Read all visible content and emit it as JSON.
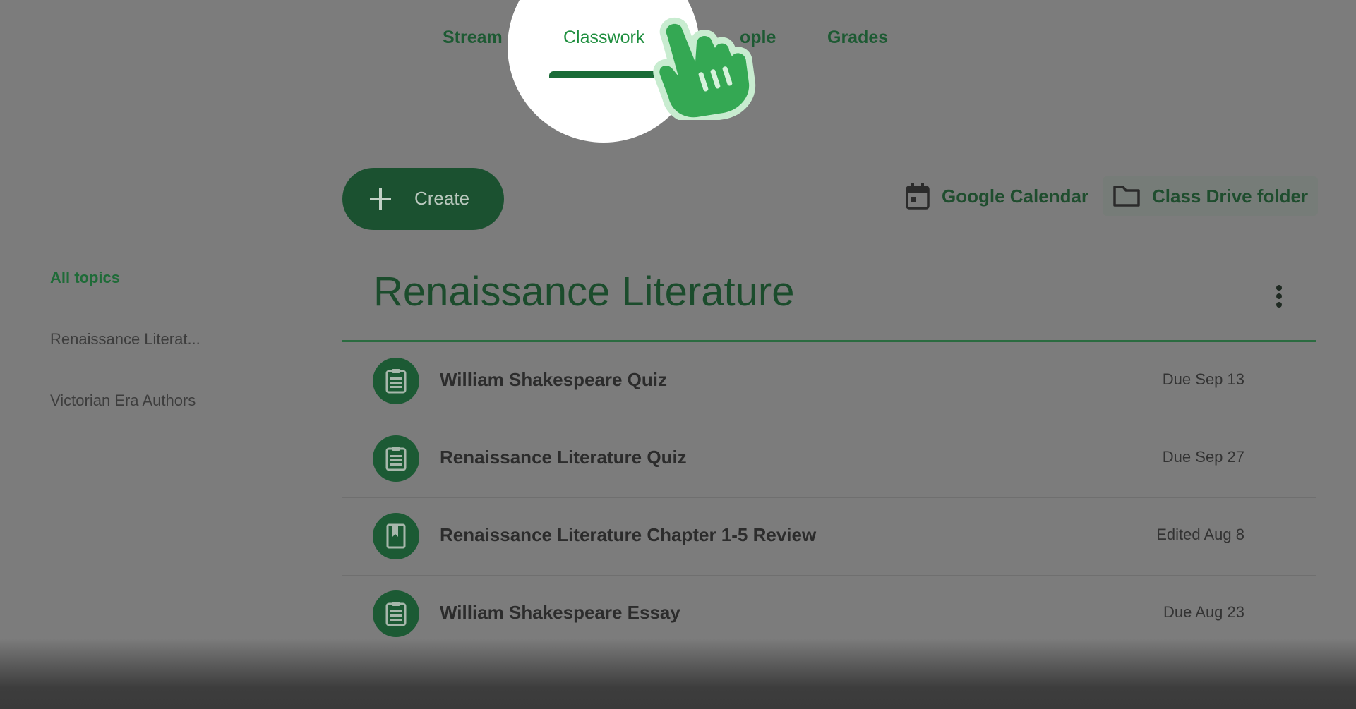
{
  "tabs": {
    "stream": "Stream",
    "classwork": "Classwork",
    "people": "ople",
    "grades": "Grades"
  },
  "toolbar": {
    "create_label": "Create",
    "calendar_label": "Google Calendar",
    "drive_label": "Class Drive folder"
  },
  "sidebar": {
    "items": [
      {
        "label": "All topics"
      },
      {
        "label": "Renaissance Literat..."
      },
      {
        "label": "Victorian Era Authors"
      }
    ]
  },
  "topic": {
    "title": "Renaissance Literature"
  },
  "assignments": [
    {
      "title": "William Shakespeare Quiz",
      "date": "Due Sep 13",
      "icon": "assignment-icon"
    },
    {
      "title": "Renaissance Literature Quiz",
      "date": "Due Sep 27",
      "icon": "assignment-icon"
    },
    {
      "title": "Renaissance Literature Chapter 1-5 Review",
      "date": "Edited Aug 8",
      "icon": "material-book-icon"
    },
    {
      "title": "William Shakespeare Essay",
      "date": "Due Aug 23",
      "icon": "assignment-icon"
    }
  ],
  "colors": {
    "accent": "#1e8e3e",
    "overlay": "#7c7c7c",
    "spotlight": "#ffffff",
    "cursor": "#34a853"
  }
}
